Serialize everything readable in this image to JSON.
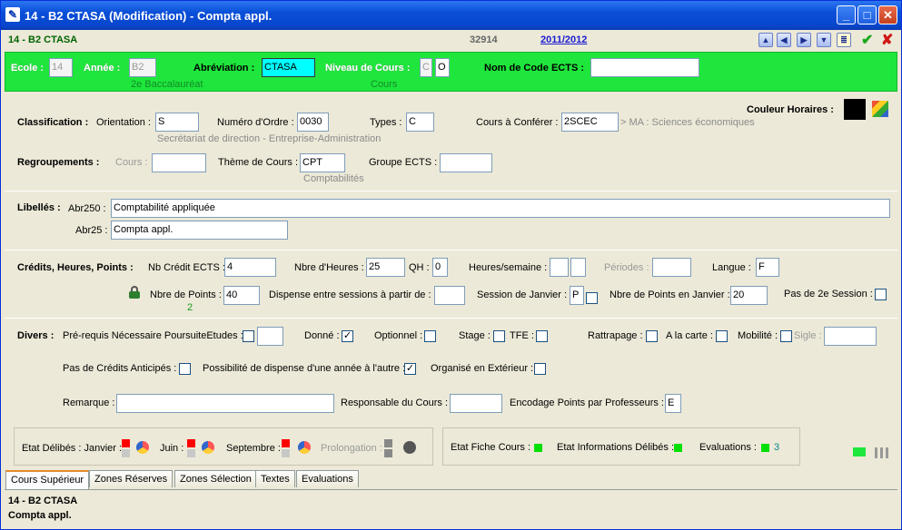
{
  "window": {
    "title": "14 - B2    CTASA (Modification) - Compta appl."
  },
  "header2": {
    "code": "14 - B2    CTASA",
    "number": "32914",
    "year": "2011/2012"
  },
  "green": {
    "ecole_label": "Ecole :",
    "ecole_value": "14",
    "annee_label": "Année :",
    "annee_value": "B2",
    "annee_sub": "2e Baccalauréat",
    "abrev_label": "Abréviation :",
    "abrev_value": "CTASA",
    "niveau_label": "Niveau de Cours :",
    "niveau_v1": "C",
    "niveau_v2": "O",
    "niveau_sub": "Cours",
    "ects_label": "Nom de Code ECTS :",
    "ects_value": ""
  },
  "couleur": {
    "label": "Couleur Horaires :",
    "color": "#000000"
  },
  "classification": {
    "label": "Classification :",
    "orientation_label": "Orientation :",
    "orientation_value": "S",
    "orientation_sub": "Secrétariat de direction - Entreprise-Administration",
    "numero_label": "Numéro d'Ordre :",
    "numero_value": "0030",
    "types_label": "Types :",
    "types_value": "C",
    "conferer_label": "Cours à Conférer :",
    "conferer_value": "2SCEC",
    "conferer_desc": "> MA : Sciences économiques"
  },
  "regroupements": {
    "label": "Regroupements :",
    "cours_label": "Cours :",
    "cours_value": "",
    "theme_label": "Thème de Cours :",
    "theme_value": "CPT",
    "theme_sub": "Comptabilités",
    "groupe_label": "Groupe ECTS :",
    "groupe_value": ""
  },
  "libelles": {
    "label": "Libellés :",
    "abr250_label": "Abr250 :",
    "abr250_value": "Comptabilité appliquée",
    "abr25_label": "Abr25 :",
    "abr25_value": "Compta appl."
  },
  "credits": {
    "label": "Crédits, Heures, Points :",
    "nb_credit_label": "Nb Crédit ECTS :",
    "nb_credit_value": "4",
    "nbre_heures_label": "Nbre d'Heures :",
    "nbre_heures_value": "25",
    "qh_label": "QH :",
    "qh_value": "0",
    "heures_sem_label": "Heures/semaine :",
    "heures_sem_v1": "",
    "heures_sem_v2": "",
    "periodes_label": "Périodes :",
    "periodes_value": "",
    "langue_label": "Langue :",
    "langue_value": "F",
    "lock_count": "2",
    "nbre_points_label": "Nbre de Points :",
    "nbre_points_value": "40",
    "dispense_label": "Dispense entre sessions à partir de :",
    "dispense_value": "",
    "session_jan_label": "Session de Janvier :",
    "session_jan_value": "P",
    "points_jan_label": "Nbre de Points en Janvier :",
    "points_jan_value": "20",
    "pas2e_label": "Pas de 2e Session :"
  },
  "divers": {
    "label": "Divers :",
    "prerequis_label": "Pré-requis Nécessaire PoursuiteEtudes :",
    "donne_label": "Donné :",
    "optionnel_label": "Optionnel :",
    "stage_label": "Stage :",
    "tfe_label": "TFE :",
    "rattrapage_label": "Rattrapage :",
    "alacarte_label": "A la carte :",
    "mobilite_label": "Mobilité :",
    "sigle_label": "Sigle :",
    "pas_credits_label": "Pas de Crédits Anticipés :",
    "possibilite_label": "Possibilité de dispense d'une année à l'autre :",
    "organise_label": "Organisé en Extérieur :",
    "remarque_label": "Remarque :",
    "remarque_value": "",
    "responsable_label": "Responsable du Cours :",
    "responsable_value": "",
    "encodage_label": "Encodage Points par Professeurs :",
    "encodage_value": "E"
  },
  "etat": {
    "label": "Etat Délibés : Janvier :",
    "juin_label": "Juin :",
    "sept_label": "Septembre :",
    "prolong_label": "Prolongation :",
    "fiche_label": "Etat Fiche Cours :",
    "infos_label": "Etat Informations Délibés :",
    "eval_label": "Evaluations :",
    "eval_count": "3"
  },
  "tabs": [
    "Cours Supérieur",
    "Zones Réserves",
    "Zones Sélection",
    "Textes",
    "Evaluations"
  ],
  "footer": {
    "line1": "14 - B2    CTASA",
    "line2": "Compta appl."
  }
}
